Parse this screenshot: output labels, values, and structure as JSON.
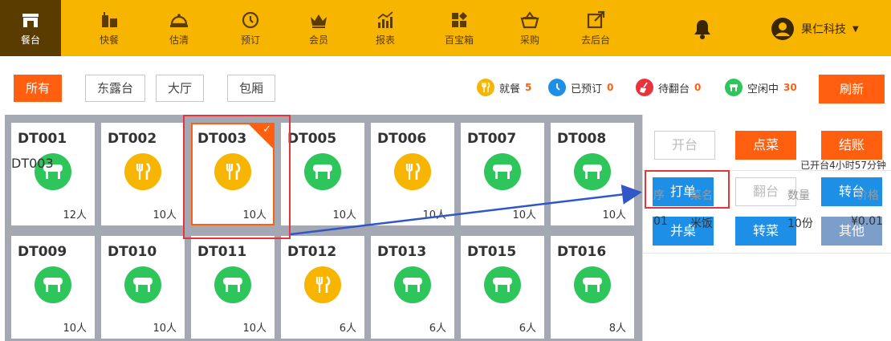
{
  "nav": {
    "items": [
      {
        "label": "餐台",
        "icon": "store-icon"
      },
      {
        "label": "快餐",
        "icon": "fast-food-icon"
      },
      {
        "label": "估清",
        "icon": "cloche-icon"
      },
      {
        "label": "预订",
        "icon": "clock-icon"
      },
      {
        "label": "会员",
        "icon": "crown-icon"
      },
      {
        "label": "报表",
        "icon": "chart-icon"
      },
      {
        "label": "百宝箱",
        "icon": "toolbox-icon"
      },
      {
        "label": "采购",
        "icon": "basket-icon"
      },
      {
        "label": "去后台",
        "icon": "external-link-icon"
      }
    ],
    "active_index": 0,
    "user_label": "果仁科技",
    "colors": {
      "bar": "#f7b500",
      "active": "#5a3c00"
    }
  },
  "filters": {
    "all": "所有",
    "dong": "东露台",
    "hall": "大厅",
    "room": "包厢"
  },
  "status": {
    "dining": {
      "label": "就餐",
      "count": "5",
      "color": "#f7b500"
    },
    "reserved": {
      "label": "已预订",
      "count": "0",
      "color": "#1e8fe6"
    },
    "cleaning": {
      "label": "待翻台",
      "count": "0",
      "color": "#e8333a"
    },
    "free": {
      "label": "空闲中",
      "count": "30",
      "color": "#2ec55a"
    }
  },
  "refresh_label": "刷新",
  "tables": [
    {
      "name": "DT001",
      "cap": "12人",
      "state": "free"
    },
    {
      "name": "DT002",
      "cap": "10人",
      "state": "dining"
    },
    {
      "name": "DT003",
      "cap": "10人",
      "state": "dining",
      "selected": true
    },
    {
      "name": "DT005",
      "cap": "10人",
      "state": "free"
    },
    {
      "name": "DT006",
      "cap": "10人",
      "state": "dining"
    },
    {
      "name": "DT007",
      "cap": "10人",
      "state": "free"
    },
    {
      "name": "DT008",
      "cap": "10人",
      "state": "free"
    },
    {
      "name": "DT009",
      "cap": "10人",
      "state": "free"
    },
    {
      "name": "DT010",
      "cap": "10人",
      "state": "free"
    },
    {
      "name": "DT011",
      "cap": "10人",
      "state": "free"
    },
    {
      "name": "DT012",
      "cap": "6人",
      "state": "dining"
    },
    {
      "name": "DT013",
      "cap": "6人",
      "state": "free"
    },
    {
      "name": "DT015",
      "cap": "6人",
      "state": "free"
    },
    {
      "name": "DT016",
      "cap": "8人",
      "state": "free"
    }
  ],
  "actions": {
    "open": "开台",
    "order": "点菜",
    "checkout": "结账",
    "print": "打单",
    "turnover": "翻台",
    "transfer": "转台",
    "merge": "并桌",
    "move_dish": "转菜",
    "other": "其他"
  },
  "order": {
    "table": "DT003",
    "elapsed": "已开台4小时57分钟",
    "headers": {
      "seq": "序",
      "dish": "菜名",
      "qty": "数量",
      "price": "价格"
    },
    "rows": [
      {
        "seq": "01",
        "dish": "米饭",
        "qty": "10份",
        "price": "¥0.01"
      }
    ]
  }
}
